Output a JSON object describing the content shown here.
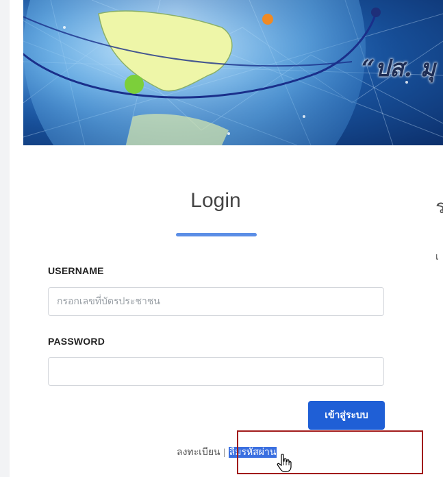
{
  "banner": {
    "title": "“ปส. มุ"
  },
  "login": {
    "heading": "Login",
    "username_label": "USERNAME",
    "username_placeholder": "กรอกเลขที่บัตรประชาชน",
    "password_label": "PASSWORD",
    "submit_label": "เข้าสู่ระบบ",
    "register_link": "ลงทะเบียน",
    "separator": "|",
    "forgot_link": "ลืมรหัสผ่าน"
  },
  "right_column": {
    "heading_partial": "ร",
    "text_partial": "เ"
  },
  "icons": {
    "cursor": "hand-pointer-icon"
  },
  "colors": {
    "accent": "#1f5fd6",
    "underline": "#5b8ee6",
    "highlight_box": "#a11b1b",
    "selection": "#3a6fe0"
  }
}
